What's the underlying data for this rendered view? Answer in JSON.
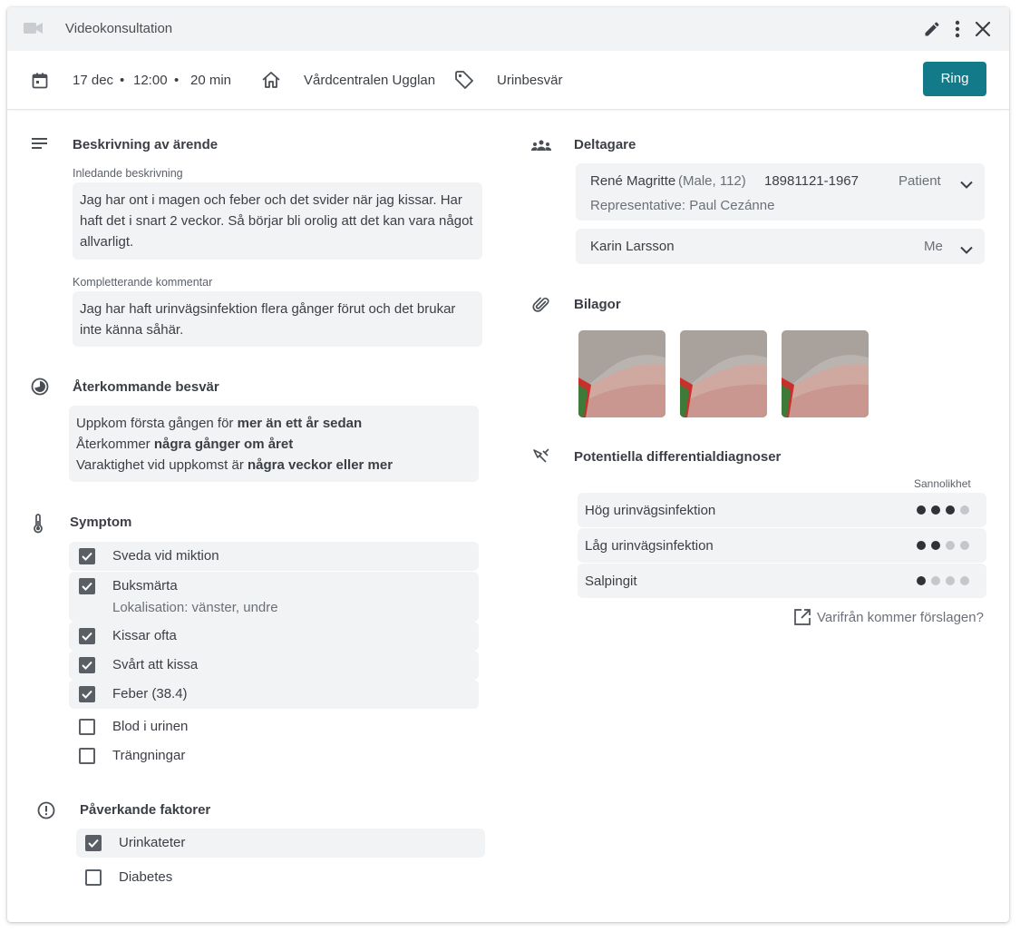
{
  "header": {
    "title": "Videokonsultation",
    "icons": [
      "videocam-icon",
      "edit-icon",
      "more-vert-icon",
      "close-icon"
    ]
  },
  "info": {
    "date": "17 dec",
    "time": "12:00",
    "duration": "20 min",
    "sep": "•",
    "clinic": "Vårdcentralen Ugglan",
    "tag": "Urinbesvär",
    "call_label": "Ring",
    "accent": "#137a8a"
  },
  "description": {
    "heading": "Beskrivning av ärende",
    "initial_label": "Inledande beskrivning",
    "initial_text": "Jag har ont i magen och feber och det svider när jag kissar. Har haft det i snart 2 veckor.  Så börjar bli orolig att det kan vara något allvarligt.",
    "comment_label": "Kompletterande kommentar",
    "comment_text": "Jag har haft urinvägsinfektion flera gånger förut och det brukar inte känna såhär."
  },
  "recurring": {
    "heading": "Återkommande besvär",
    "lines": [
      {
        "prefix": "Uppkom första gången för ",
        "bold": "mer än ett år  sedan"
      },
      {
        "prefix": "Återkommer ",
        "bold": "några gånger om året"
      },
      {
        "prefix": "Varaktighet vid uppkomst är ",
        "bold": "några veckor eller mer"
      }
    ]
  },
  "symptoms": {
    "heading": "Symptom",
    "items": [
      {
        "label": "Sveda vid miktion",
        "checked": true
      },
      {
        "label": "Buksmärta",
        "checked": true,
        "detail": "Lokalisation: vänster, undre"
      },
      {
        "label": "Kissar ofta",
        "checked": true
      },
      {
        "label": "Svårt att kissa",
        "checked": true
      },
      {
        "label": "Feber (38.4)",
        "checked": true
      },
      {
        "label": "Blod i urinen",
        "checked": false
      },
      {
        "label": "Trängningar",
        "checked": false
      }
    ]
  },
  "factors": {
    "heading": "Påverkande faktorer",
    "items": [
      {
        "label": "Urinkateter",
        "checked": true
      },
      {
        "label": "Diabetes",
        "checked": false
      }
    ]
  },
  "participants": {
    "heading": "Deltagare",
    "items": [
      {
        "name": "René Magritte",
        "meta": "(Male, 112)",
        "id": "18981121-1967",
        "role": "Patient",
        "rep": "Representative: Paul Cezánne"
      },
      {
        "name": "Karin Larsson",
        "role": "Me"
      }
    ]
  },
  "attachments": {
    "heading": "Bilagor",
    "count": 3
  },
  "diagnoses": {
    "heading": "Potentiella differentialdiagnoser",
    "likelihood_label": "Sannolikhet",
    "items": [
      {
        "label": "Hög urinvägsinfektion",
        "likelihood": 3,
        "max": 4
      },
      {
        "label": "Låg urinvägsinfektion",
        "likelihood": 2,
        "max": 4
      },
      {
        "label": "Salpingit",
        "likelihood": 1,
        "max": 4
      }
    ],
    "source_link": "Varifrån kommer förslagen?"
  }
}
